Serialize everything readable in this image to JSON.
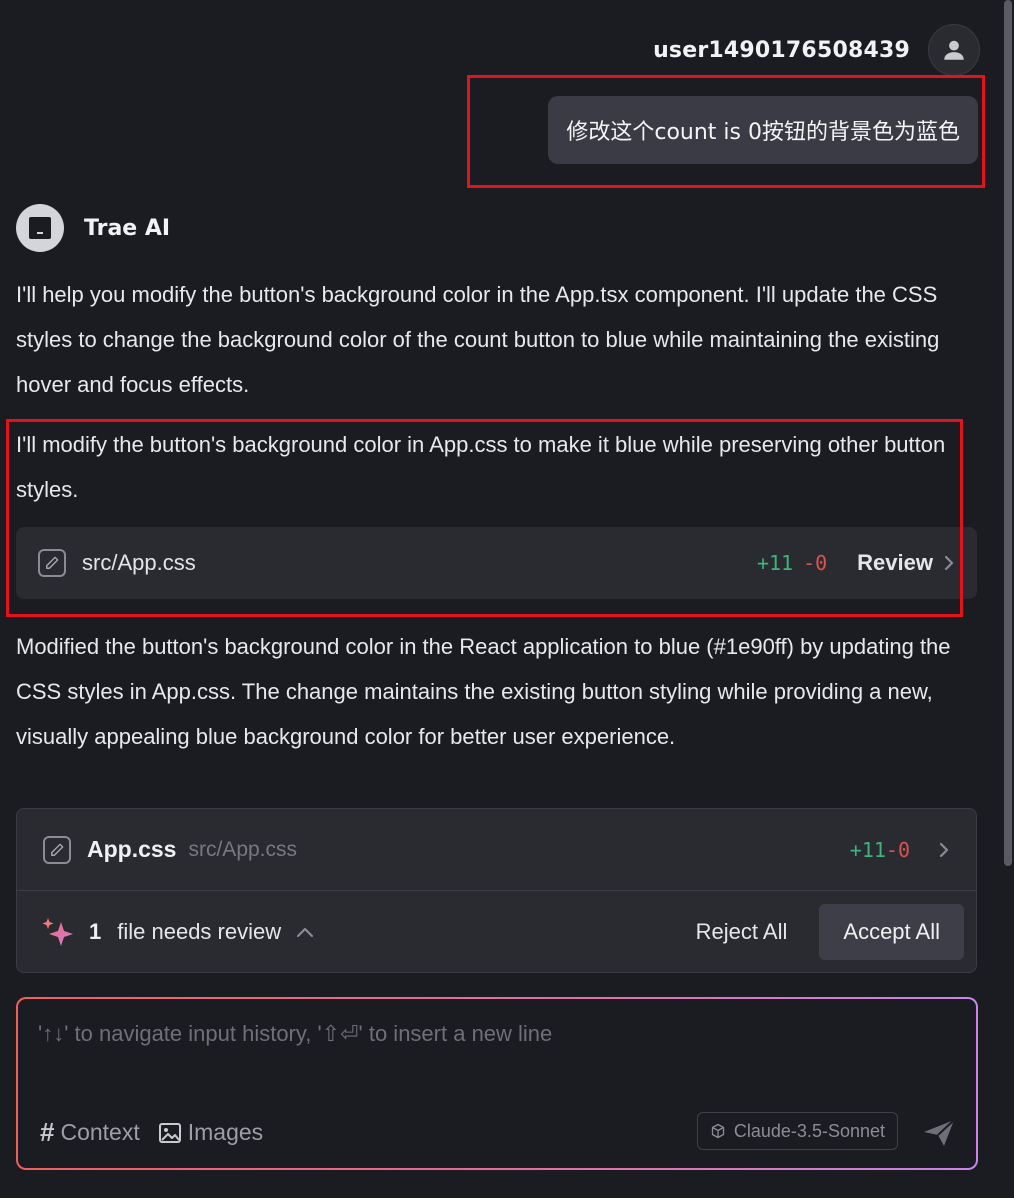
{
  "user": {
    "name": "user1490176508439",
    "message": "修改这个count is 0按钮的背景色为蓝色"
  },
  "ai": {
    "name": "Trae AI",
    "paragraph_1": "I'll help you modify the button's background color in the App.tsx component. I'll update the CSS styles to change the background color of the count button to blue while maintaining the existing hover and focus effects.",
    "paragraph_2": "I'll modify the button's background color in App.css to make it blue while preserving other button styles.",
    "paragraph_3": "Modified the button's background color in the React application to blue (#1e90ff) by updating the CSS styles in App.css. The change maintains the existing button styling while providing a new, visually appealing blue background color for better user experience."
  },
  "file_change": {
    "path": "src/App.css",
    "added": "+11",
    "removed": "-0",
    "review_label": "Review"
  },
  "review_panel": {
    "file_name": "App.css",
    "file_path": "src/App.css",
    "added": "+11",
    "removed": "-0",
    "count": "1",
    "needs_review_label": "file needs review",
    "reject_label": "Reject All",
    "accept_label": "Accept All"
  },
  "input": {
    "placeholder": "'↑↓' to navigate input history, '⇧⏎' to insert a new line",
    "context_label": "Context",
    "images_label": "Images",
    "model_label": "Claude-3.5-Sonnet"
  },
  "colors": {
    "background": "#1b1c21",
    "added": "#3fb37a",
    "removed": "#d9534f",
    "highlight": "#e3131b"
  }
}
